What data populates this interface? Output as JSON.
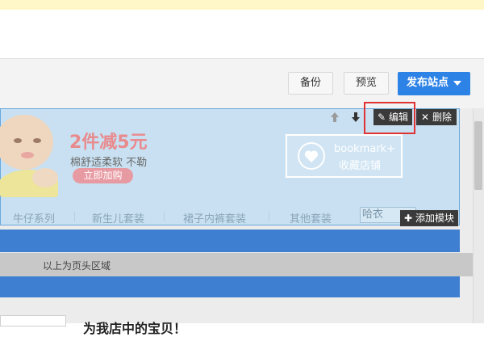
{
  "toolbar": {
    "backup_label": "备份",
    "preview_label": "预览",
    "publish_label": "发布站点"
  },
  "header_module": {
    "promo_headline": "2件减5元",
    "promo_sub": "棉舒适柔软 不勒",
    "promo_button": "立即加购",
    "bookmark_en": "bookmark+",
    "bookmark_cn": "收藏店铺",
    "nav_items": [
      "牛仔系列",
      "新生儿套装",
      "裙子内裤套装",
      "其他套装"
    ],
    "search_value": "哈衣"
  },
  "module_controls": {
    "edit_label": "编辑",
    "delete_label": "删除",
    "add_module_label": "添加模块"
  },
  "page_area": {
    "header_area_label": "以上为页头区域",
    "bottom_text": "为我店中的宝贝！"
  },
  "icons": {
    "edit": "pencil-icon",
    "delete": "close-icon",
    "add": "plus-icon",
    "move_up": "arrow-up-icon",
    "move_down": "arrow-down-icon",
    "bookmark": "heart-icon",
    "publish": "caret-down-icon"
  },
  "colors": {
    "accent_blue": "#2d82e6",
    "band_blue": "#3e7fd2",
    "highlight_red": "#e03434",
    "module_bg": "#c8e0f1",
    "promo_pink": "#e98a8d"
  }
}
